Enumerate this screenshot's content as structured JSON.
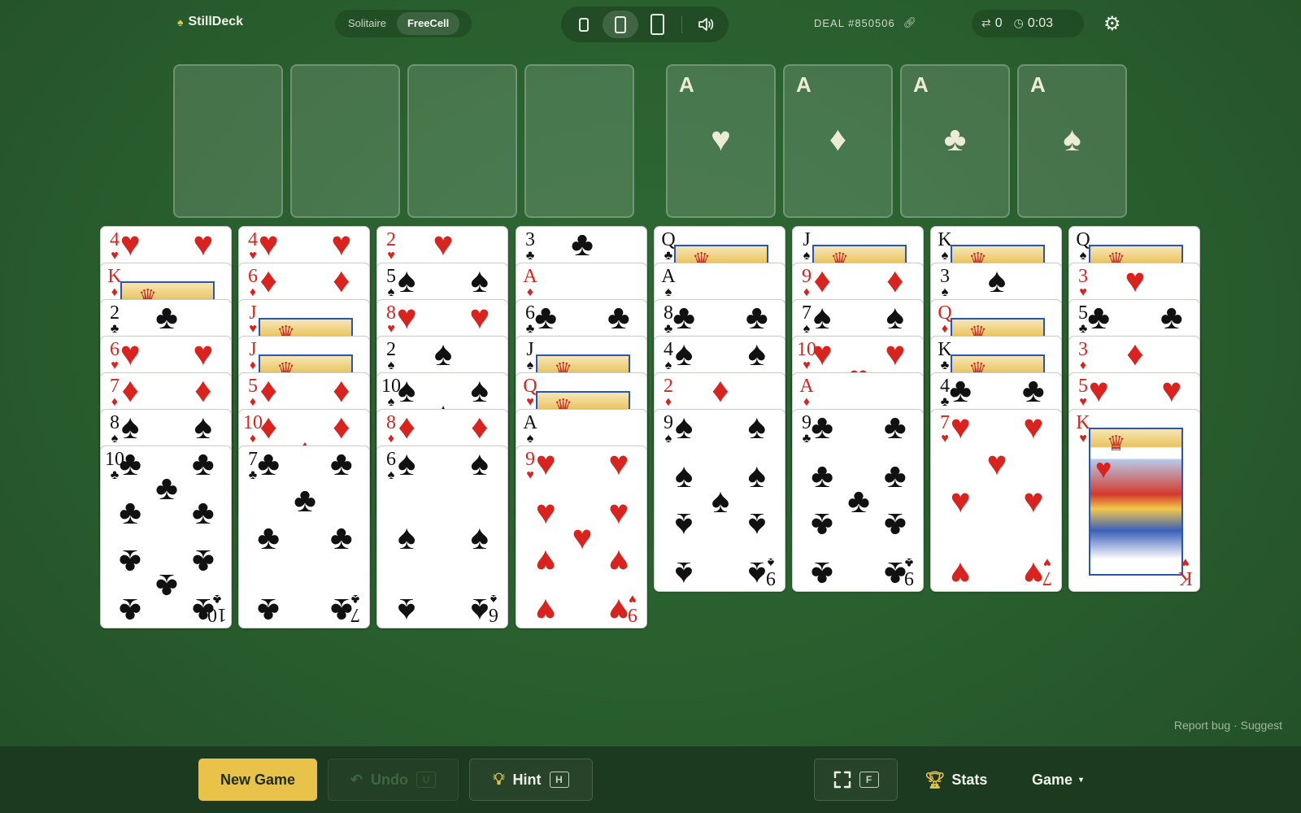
{
  "header": {
    "brand": "StillDeck",
    "brand_icon": "spade-icon",
    "modes": [
      "Solitaire",
      "FreeCell"
    ],
    "active_mode": "FreeCell",
    "deal_label": "DEAL #850506",
    "moves": "0",
    "timer": "0:03"
  },
  "foundations": [
    {
      "rank": "A",
      "suit": "♥"
    },
    {
      "rank": "A",
      "suit": "♦"
    },
    {
      "rank": "A",
      "suit": "♣"
    },
    {
      "rank": "A",
      "suit": "♠"
    }
  ],
  "tableau": [
    [
      [
        "4",
        "♥"
      ],
      [
        "K",
        "♦"
      ],
      [
        "2",
        "♣"
      ],
      [
        "6",
        "♥"
      ],
      [
        "7",
        "♦"
      ],
      [
        "8",
        "♠"
      ],
      [
        "10",
        "♣"
      ]
    ],
    [
      [
        "4",
        "♥"
      ],
      [
        "6",
        "♦"
      ],
      [
        "J",
        "♥"
      ],
      [
        "J",
        "♦"
      ],
      [
        "5",
        "♦"
      ],
      [
        "10",
        "♦"
      ],
      [
        "7",
        "♣"
      ]
    ],
    [
      [
        "2",
        "♥"
      ],
      [
        "5",
        "♠"
      ],
      [
        "8",
        "♥"
      ],
      [
        "2",
        "♠"
      ],
      [
        "10",
        "♠"
      ],
      [
        "8",
        "♦"
      ],
      [
        "6",
        "♠"
      ]
    ],
    [
      [
        "3",
        "♣"
      ],
      [
        "A",
        "♦"
      ],
      [
        "6",
        "♣"
      ],
      [
        "J",
        "♠"
      ],
      [
        "Q",
        "♥"
      ],
      [
        "A",
        "♠"
      ],
      [
        "9",
        "♥"
      ]
    ],
    [
      [
        "Q",
        "♣"
      ],
      [
        "A",
        "♠"
      ],
      [
        "8",
        "♣"
      ],
      [
        "4",
        "♠"
      ],
      [
        "2",
        "♦"
      ],
      [
        "9",
        "♠"
      ]
    ],
    [
      [
        "J",
        "♠"
      ],
      [
        "9",
        "♦"
      ],
      [
        "7",
        "♠"
      ],
      [
        "10",
        "♥"
      ],
      [
        "A",
        "♦"
      ],
      [
        "9",
        "♣"
      ]
    ],
    [
      [
        "K",
        "♠"
      ],
      [
        "3",
        "♠"
      ],
      [
        "Q",
        "♦"
      ],
      [
        "K",
        "♣"
      ],
      [
        "4",
        "♣"
      ],
      [
        "7",
        "♥"
      ]
    ],
    [
      [
        "Q",
        "♠"
      ],
      [
        "3",
        "♥"
      ],
      [
        "5",
        "♣"
      ],
      [
        "3",
        "♦"
      ],
      [
        "5",
        "♥"
      ],
      [
        "K",
        "♥"
      ]
    ]
  ],
  "footer": {
    "report": "Report bug · Suggest",
    "new_game": "New Game",
    "undo": "Undo",
    "undo_key": "U",
    "hint": "Hint",
    "hint_key": "H",
    "fullscreen_key": "F",
    "stats": "Stats",
    "game": "Game"
  },
  "colors": {
    "felt": "#2a5e2e",
    "accent": "#e9c24a",
    "red": "#d8231e",
    "black": "#111111"
  }
}
